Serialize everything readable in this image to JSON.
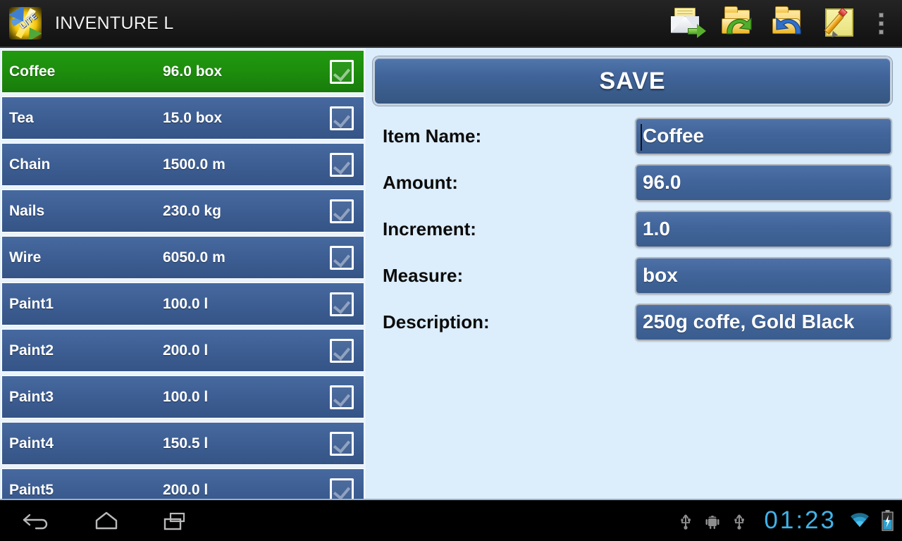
{
  "titlebar": {
    "app_title": "INVENTURE L",
    "logo_text": "LITE",
    "icons": [
      {
        "name": "send-email-icon",
        "label": "Send by e-mail"
      },
      {
        "name": "export-folder-icon",
        "label": "Export"
      },
      {
        "name": "import-folder-icon",
        "label": "Import"
      },
      {
        "name": "edit-note-icon",
        "label": "New / Edit item"
      }
    ],
    "overflow_label": "More options"
  },
  "list": {
    "rows": [
      {
        "name": "Coffee",
        "amount": "96.0 box",
        "checked": true,
        "selected": true
      },
      {
        "name": "Tea",
        "amount": "15.0 box",
        "checked": true,
        "selected": false
      },
      {
        "name": "Chain",
        "amount": "1500.0 m",
        "checked": true,
        "selected": false
      },
      {
        "name": "Nails",
        "amount": "230.0 kg",
        "checked": true,
        "selected": false
      },
      {
        "name": "Wire",
        "amount": "6050.0 m",
        "checked": true,
        "selected": false
      },
      {
        "name": "Paint1",
        "amount": "100.0 l",
        "checked": true,
        "selected": false
      },
      {
        "name": "Paint2",
        "amount": "200.0 l",
        "checked": true,
        "selected": false
      },
      {
        "name": "Paint3",
        "amount": "100.0 l",
        "checked": true,
        "selected": false
      },
      {
        "name": "Paint4",
        "amount": "150.5 l",
        "checked": true,
        "selected": false
      },
      {
        "name": "Paint5",
        "amount": "200.0 l",
        "checked": true,
        "selected": false
      }
    ]
  },
  "form": {
    "save_label": "SAVE",
    "fields": [
      {
        "key": "item_name",
        "label": "Item Name:",
        "value": "Coffee",
        "focused": true
      },
      {
        "key": "amount",
        "label": "Amount:",
        "value": "96.0",
        "focused": false
      },
      {
        "key": "increment",
        "label": "Increment:",
        "value": "1.0",
        "focused": false
      },
      {
        "key": "measure",
        "label": "Measure:",
        "value": "box",
        "focused": false
      },
      {
        "key": "description",
        "label": "Description:",
        "value": "250g coffe, Gold Black",
        "focused": false
      }
    ]
  },
  "navbar": {
    "back_label": "Back",
    "home_label": "Home",
    "recents_label": "Recent apps",
    "status": {
      "clock": "01:23",
      "icons": [
        "usb-icon",
        "android-debug-icon",
        "usb-icon",
        "wifi-icon",
        "battery-charging-icon"
      ]
    }
  },
  "colors": {
    "selected_row": "#1d8d0d",
    "row_blue": "#3d5e93",
    "panel_bg": "#dcedfb",
    "titlebar_bg": "#1b1b1b",
    "clock_cyan": "#3fb3e8"
  }
}
